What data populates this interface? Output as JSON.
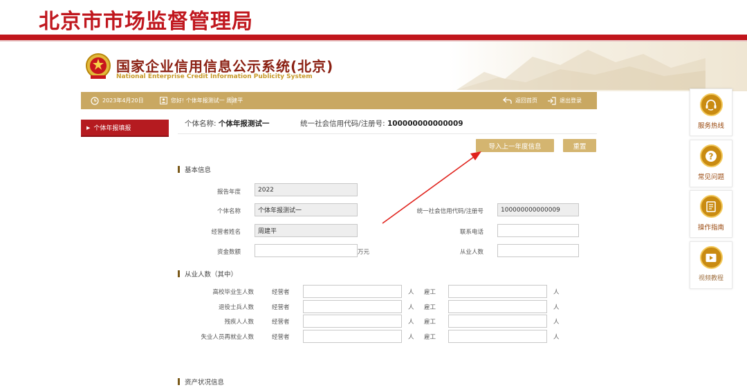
{
  "header": {
    "bureau_title": "北京市市场监督管理局",
    "system_title": "国家企业信用信息公示系统(北京)",
    "system_subtitle": "National Enterprise Credit Information Publicity System"
  },
  "toolbar": {
    "date": "2023年4月20日",
    "greeting": "您好! 个体年报测试一 周建平",
    "home_label": "返回首页",
    "logout_label": "退出登录"
  },
  "nav": {
    "items": [
      {
        "label": "个体年报填报"
      }
    ]
  },
  "entity": {
    "name_label": "个体名称:",
    "name_value": "个体年报测试一",
    "code_label": "统一社会信用代码/注册号:",
    "code_value": "100000000000009"
  },
  "actions": {
    "import_label": "导入上一年度信息",
    "reset_label": "重置"
  },
  "basic": {
    "section_title": "基本信息",
    "fields": {
      "year_label": "报告年度",
      "year_value": "2022",
      "name_label": "个体名称",
      "name_value": "个体年报测试一",
      "code_label": "统一社会信用代码/注册号",
      "code_value": "100000000000009",
      "operator_label": "经营者姓名",
      "operator_value": "周建平",
      "phone_label": "联系电话",
      "phone_value": "",
      "capital_label": "资金数额",
      "capital_value": "",
      "capital_unit": "万元",
      "employees_label": "从业人数",
      "employees_value": ""
    }
  },
  "staff": {
    "section_title": "从业人数（其中）",
    "operator_col": "经营者",
    "employee_col": "雇工",
    "unit": "人",
    "rows": [
      {
        "label": "高校毕业生人数"
      },
      {
        "label": "退役士兵人数"
      },
      {
        "label": "残疾人人数"
      },
      {
        "label": "失业人员再就业人数"
      }
    ]
  },
  "assets": {
    "section_title": "资产状况信息"
  },
  "side": {
    "items": [
      {
        "label": "服务热线",
        "icon": "headset-icon"
      },
      {
        "label": "常见问题",
        "icon": "question-icon"
      },
      {
        "label": "操作指南",
        "icon": "guide-icon"
      },
      {
        "label": "视频教程",
        "icon": "video-icon"
      }
    ]
  },
  "colors": {
    "brand_red": "#c1161c",
    "gold": "#c9a862",
    "button_gold": "#d4b570",
    "annotation_red": "#e0221c"
  }
}
